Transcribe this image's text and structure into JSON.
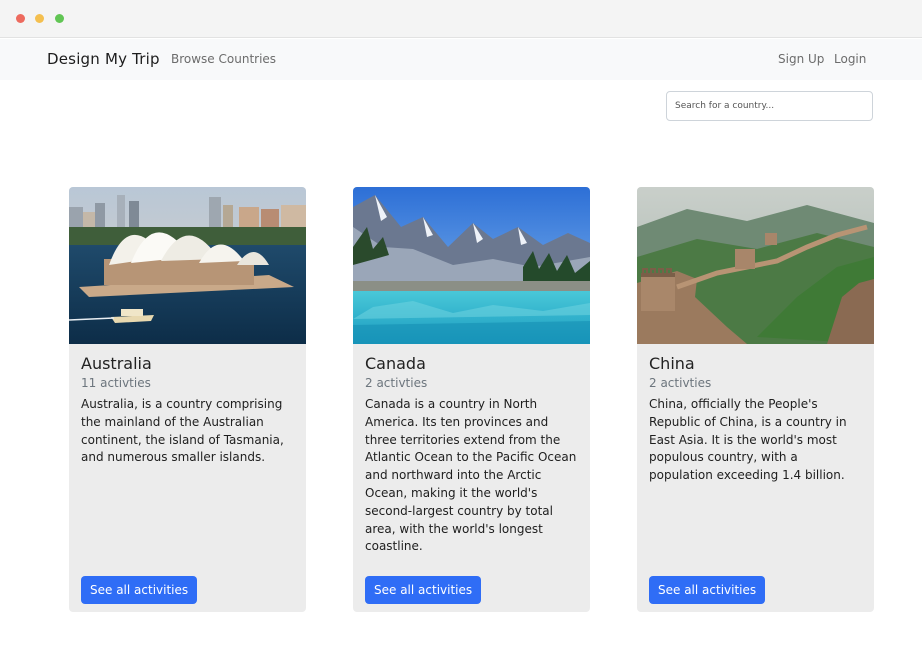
{
  "navbar": {
    "brand": "Design My Trip",
    "browse_label": "Browse Countries",
    "signup_label": "Sign Up",
    "login_label": "Login"
  },
  "search": {
    "placeholder": "Search for a country..."
  },
  "countries": [
    {
      "name": "Australia",
      "activities": "11 activties",
      "description": "Australia, is a country comprising the mainland of the Australian continent, the island of Tasmania, and numerous smaller islands.",
      "button_label": "See all activities"
    },
    {
      "name": "Canada",
      "activities": "2 activties",
      "description": "Canada is a country in North America. Its ten provinces and three territories extend from the Atlantic Ocean to the Pacific Ocean and northward into the Arctic Ocean, making it the world's second-largest country by total area, with the world's longest coastline.",
      "button_label": "See all activities"
    },
    {
      "name": "China",
      "activities": "2 activties",
      "description": "China, officially the People's Republic of China, is a country in East Asia. It is the world's most populous country, with a population exceeding 1.4 billion.",
      "button_label": "See all activities"
    }
  ],
  "colors": {
    "button": "#2f6df6",
    "card_bg": "#ececec",
    "navbar_bg": "#f8f9fa"
  }
}
